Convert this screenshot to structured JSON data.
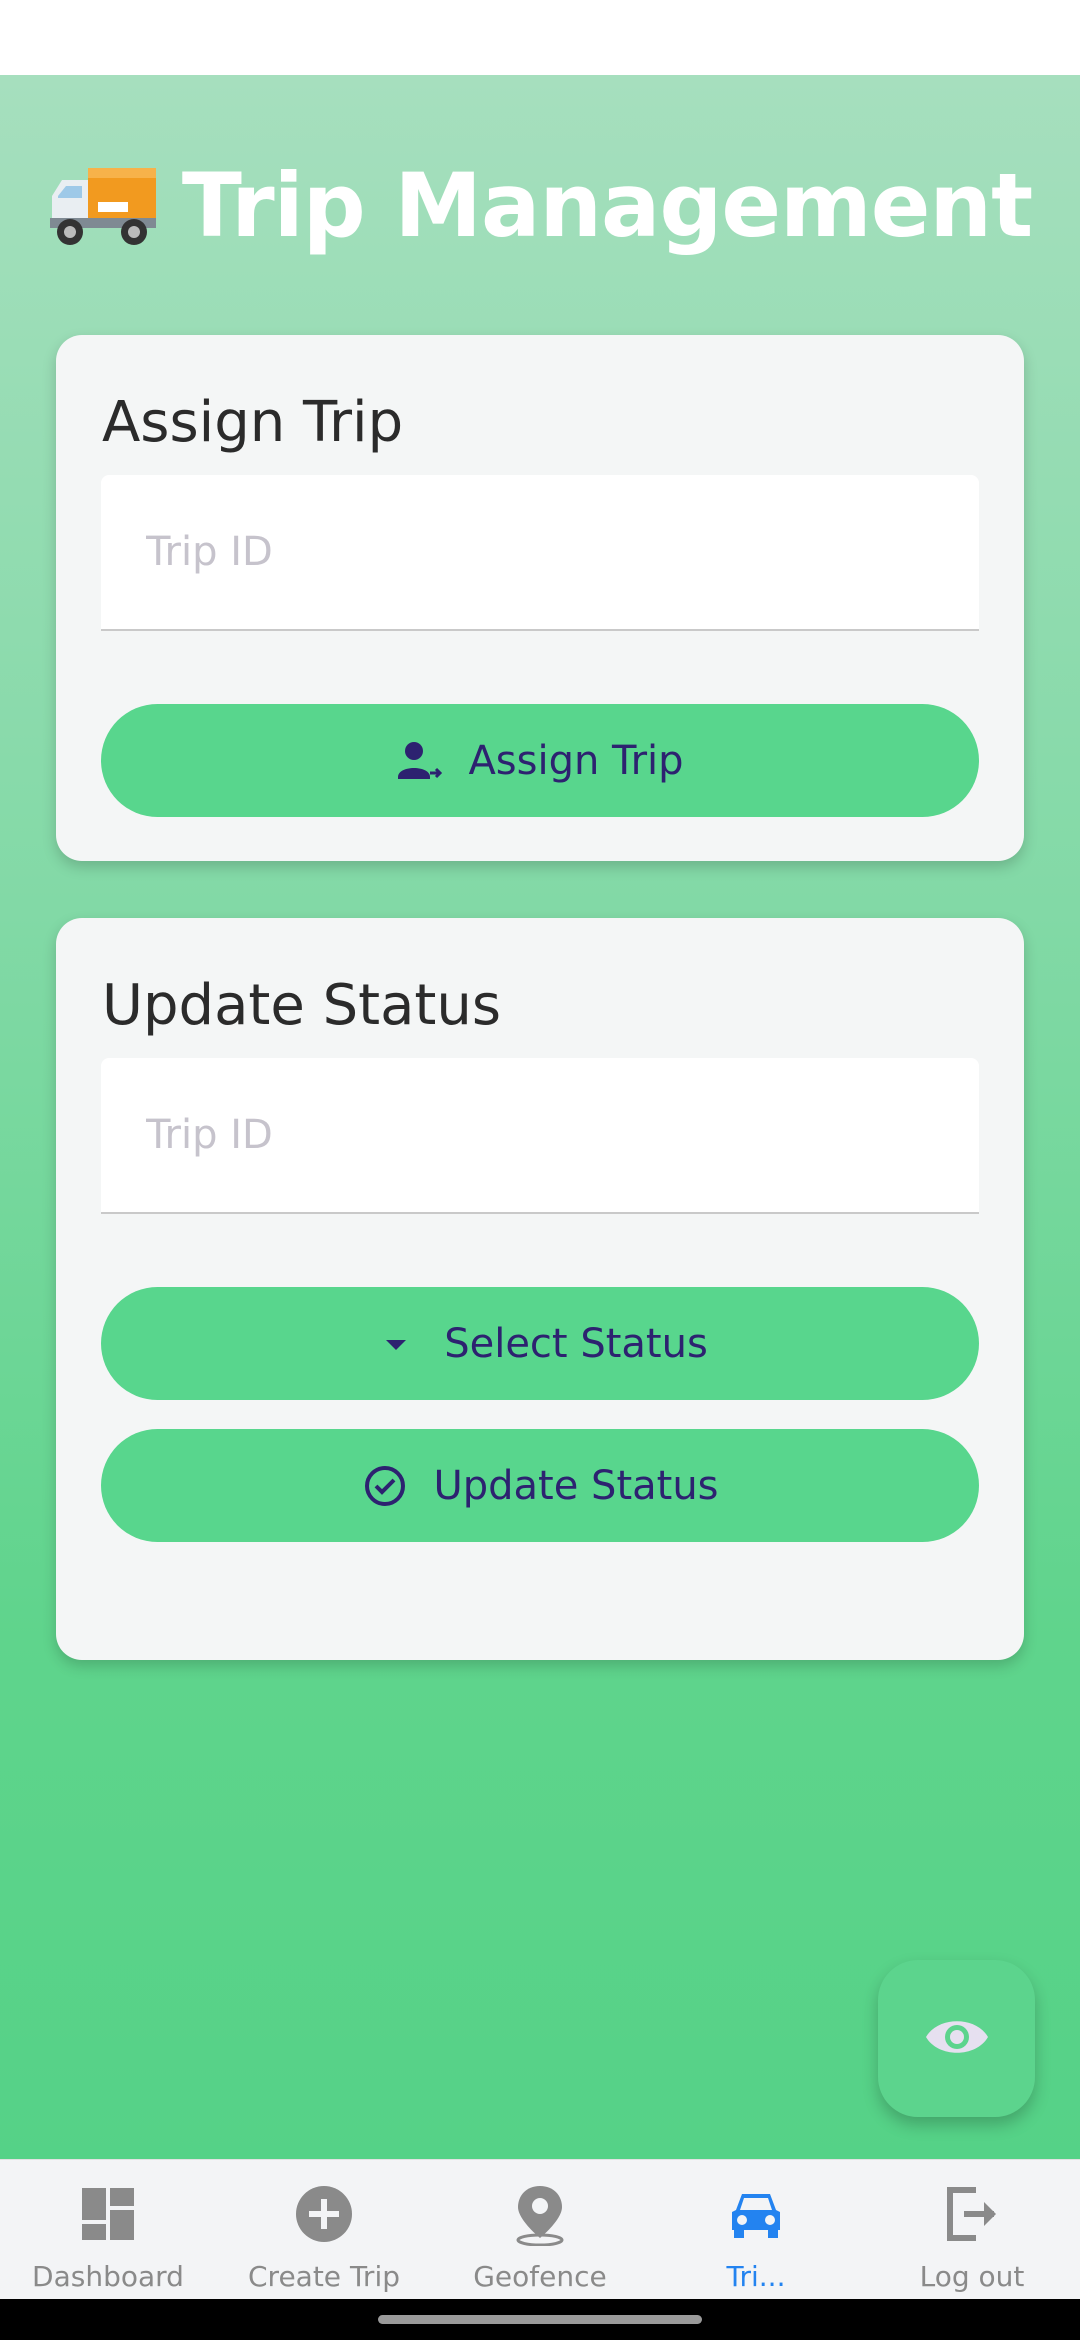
{
  "header": {
    "title": "Trip Management",
    "icon": "delivery-truck-emoji"
  },
  "assign_card": {
    "title": "Assign Trip",
    "trip_id_placeholder": "Trip ID",
    "trip_id_value": "",
    "button_label": "Assign Trip",
    "button_icon": "person-assign-icon"
  },
  "update_card": {
    "title": "Update Status",
    "trip_id_placeholder": "Trip ID",
    "trip_id_value": "",
    "select_label": "Select Status",
    "select_icon": "dropdown-arrow-icon",
    "button_label": "Update Status",
    "button_icon": "check-circle-icon"
  },
  "fab": {
    "icon": "eye-icon"
  },
  "bottom_nav": {
    "items": [
      {
        "label": "Dashboard",
        "icon": "dashboard-icon",
        "active": false
      },
      {
        "label": "Create Trip",
        "icon": "add-circle-icon",
        "active": false
      },
      {
        "label": "Geofence",
        "icon": "location-pin-icon",
        "active": false
      },
      {
        "label": "Tri...",
        "icon": "car-icon",
        "active": true
      },
      {
        "label": "Log out",
        "icon": "logout-icon",
        "active": false
      }
    ]
  },
  "colors": {
    "accent_green": "#58d68d",
    "button_text": "#2d2270",
    "nav_active": "#2383f0",
    "nav_inactive": "#8a8a8a"
  }
}
